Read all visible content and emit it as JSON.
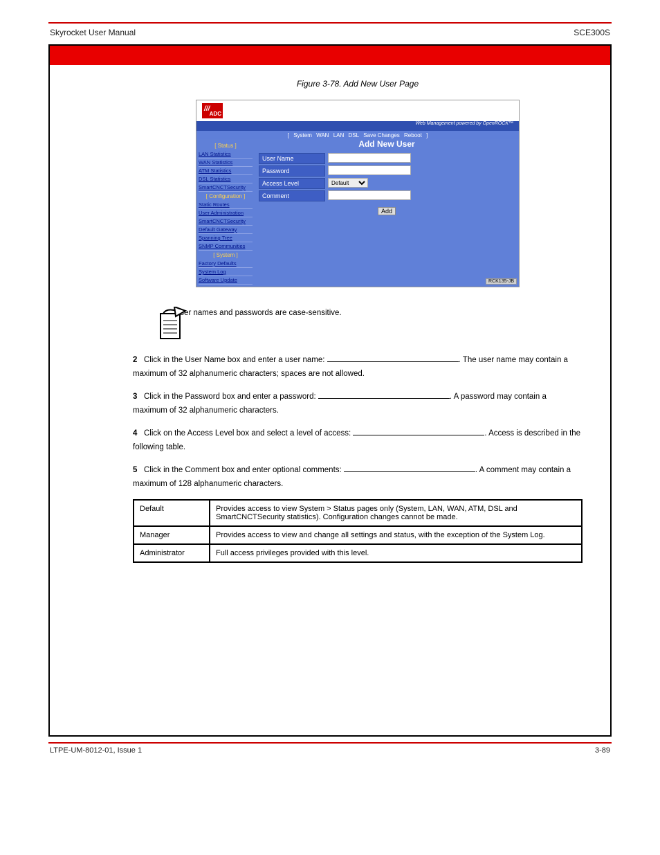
{
  "header": {
    "left": "Skyrocket User Manual",
    "right": "SCE300S"
  },
  "figure_caption": "Figure 3-78. Add New User Page",
  "screenshot": {
    "logo_text": "ADC",
    "topbar_text": "Web Management powered by OpenROCK™",
    "tabs": [
      "[",
      "System",
      "WAN",
      "LAN",
      "DSL",
      "Save Changes",
      "Reboot",
      "]"
    ],
    "sidebar": {
      "groups": [
        {
          "heading": "[ Status ]",
          "links": [
            "LAN Statistics",
            "WAN Statistics",
            "ATM Statistics",
            "DSL Statistics",
            "SmartCNCTSecurity"
          ]
        },
        {
          "heading": "[ Configuration ]",
          "links": [
            "Static Routes",
            "User Administration",
            "SmartCNCTSecurity",
            "Default Gateway",
            "Spanning Tree",
            "SNMP Communities"
          ]
        },
        {
          "heading": "[ System ]",
          "links": [
            "Factory Defaults",
            "System Log",
            "Software Update"
          ]
        }
      ]
    },
    "main_title": "Add New User",
    "form": {
      "rows": [
        {
          "label": "User Name",
          "kind": "text"
        },
        {
          "label": "Password",
          "kind": "text"
        },
        {
          "label": "Access Level",
          "kind": "select",
          "value": "Default"
        },
        {
          "label": "Comment",
          "kind": "text"
        }
      ],
      "button": "Add"
    },
    "corner_tag": "RCK135-JB"
  },
  "note": "User names and passwords are case-sensitive.",
  "steps": {
    "s2": {
      "num": "2",
      "text_a": "Click in the User Name box and enter a user name: ",
      "text_b": ". The user name may contain a maximum of 32 alphanumeric characters; spaces are not allowed."
    },
    "s3": {
      "num": "3",
      "text_a": "Click in the Password box and enter a password: ",
      "text_b": ". A password may contain a maximum of 32 alphanumeric characters."
    },
    "s4": {
      "num": "4",
      "text_a": "Click on the Access Level box and select a level of access: ",
      "text_b": ". Access is described in the following table."
    },
    "s5": {
      "num": "5",
      "text_a": "Click in the Comment box and enter optional comments: ",
      "text_b": ". A comment may contain a maximum of 128 alphanumeric characters."
    }
  },
  "table": {
    "rows": [
      {
        "c1": "Default",
        "c2": "Provides access to view System > Status pages only (System, LAN, WAN, ATM, DSL and SmartCNCTSecurity statistics). Configuration changes cannot be made."
      },
      {
        "c1": "Manager",
        "c2": "Provides access to view and change all settings and status, with the exception of the System Log."
      },
      {
        "c1": "Administrator",
        "c2": "Full access privileges provided with this level."
      }
    ]
  },
  "footer": {
    "left": "LTPE-UM-8012-01, Issue 1",
    "right": "3-89"
  }
}
